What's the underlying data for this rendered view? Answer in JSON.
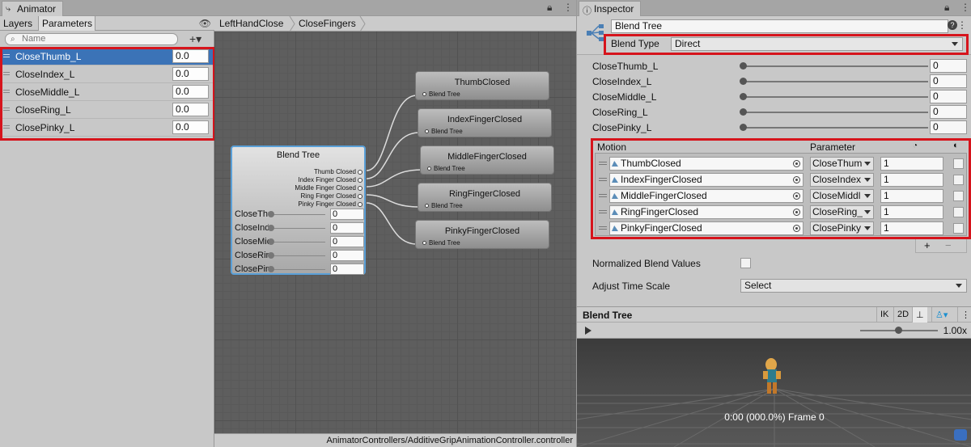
{
  "animator": {
    "tab_title": "Animator",
    "subtabs": [
      "Layers",
      "Parameters"
    ],
    "search_placeholder": "Name",
    "parameters": [
      {
        "name": "CloseThumb_L",
        "value": "0.0",
        "selected": true
      },
      {
        "name": "CloseIndex_L",
        "value": "0.0",
        "selected": false
      },
      {
        "name": "CloseMiddle_L",
        "value": "0.0",
        "selected": false
      },
      {
        "name": "CloseRing_L",
        "value": "0.0",
        "selected": false
      },
      {
        "name": "ClosePinky_L",
        "value": "0.0",
        "selected": false
      }
    ],
    "breadcrumb": [
      "LeftHandClose",
      "CloseFingers"
    ],
    "status_path": "AnimatorControllers/AdditiveGripAnimationController.controller",
    "blend_node": {
      "title": "Blend Tree",
      "outputs": [
        "Thumb Closed",
        "Index Finger Closed",
        "Middle Finger Closed",
        "Ring Finger Closed",
        "Pinky Finger Closed"
      ],
      "params": [
        {
          "label": "CloseThu",
          "value": "0"
        },
        {
          "label": "CloseInd",
          "value": "0"
        },
        {
          "label": "CloseMic",
          "value": "0"
        },
        {
          "label": "CloseRin",
          "value": "0"
        },
        {
          "label": "ClosePin",
          "value": "0"
        }
      ]
    },
    "clip_nodes": [
      {
        "title": "ThumbClosed",
        "port": "Blend Tree"
      },
      {
        "title": "IndexFingerClosed",
        "port": "Blend Tree"
      },
      {
        "title": "MiddleFingerClosed",
        "port": "Blend Tree"
      },
      {
        "title": "RingFingerClosed",
        "port": "Blend Tree"
      },
      {
        "title": "PinkyFingerClosed",
        "port": "Blend Tree"
      }
    ]
  },
  "inspector": {
    "tab_title": "Inspector",
    "name": "Blend Tree",
    "blend_type_label": "Blend Type",
    "blend_type_value": "Direct",
    "params": [
      {
        "name": "CloseThumb_L",
        "value": "0"
      },
      {
        "name": "CloseIndex_L",
        "value": "0"
      },
      {
        "name": "CloseMiddle_L",
        "value": "0"
      },
      {
        "name": "CloseRing_L",
        "value": "0"
      },
      {
        "name": "ClosePinky_L",
        "value": "0"
      }
    ],
    "motion_header": "Motion",
    "parameter_header": "Parameter",
    "motions": [
      {
        "motion": "ThumbClosed",
        "parameter": "CloseThum",
        "threshold": "1"
      },
      {
        "motion": "IndexFingerClosed",
        "parameter": "CloseIndex",
        "threshold": "1"
      },
      {
        "motion": "MiddleFingerClosed",
        "parameter": "CloseMiddl",
        "threshold": "1"
      },
      {
        "motion": "RingFingerClosed",
        "parameter": "CloseRing_",
        "threshold": "1"
      },
      {
        "motion": "PinkyFingerClosed",
        "parameter": "ClosePinky",
        "threshold": "1"
      }
    ],
    "plus_minus": [
      "+",
      "−"
    ],
    "normalized_label": "Normalized Blend Values",
    "adjust_time_label": "Adjust Time Scale",
    "adjust_time_value": "Select",
    "preview_title": "Blend Tree",
    "preview_buttons": [
      "IK",
      "2D"
    ],
    "speed_label": "1.00x",
    "frame_label": "0:00 (000.0%) Frame 0"
  },
  "colors": {
    "selection": "#3b73b7",
    "highlight_box": "#d6141c",
    "node_border": "#5aa0d8"
  }
}
